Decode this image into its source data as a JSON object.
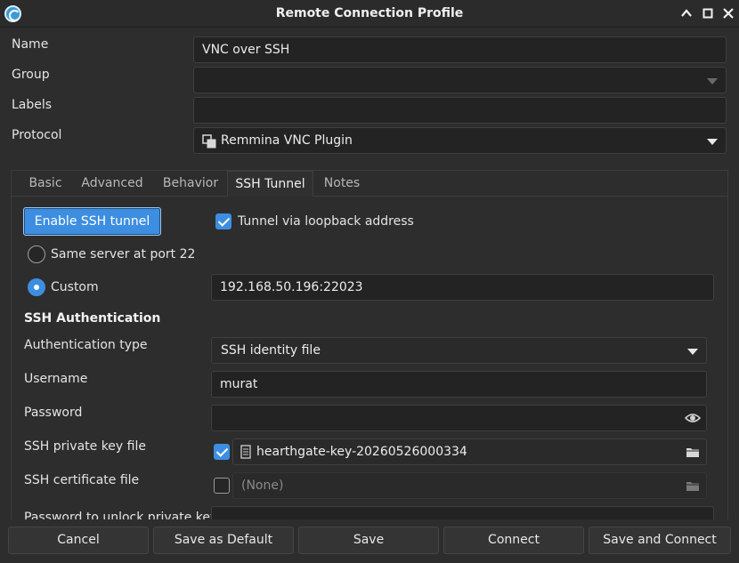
{
  "window": {
    "title": "Remote Connection Profile"
  },
  "form": {
    "name_label": "Name",
    "name_value": "VNC over SSH",
    "group_label": "Group",
    "group_value": "",
    "labels_label": "Labels",
    "labels_value": "",
    "protocol_label": "Protocol",
    "protocol_value": "Remmina VNC Plugin"
  },
  "tabs": [
    {
      "label": "Basic",
      "active": false
    },
    {
      "label": "Advanced",
      "active": false
    },
    {
      "label": "Behavior",
      "active": false
    },
    {
      "label": "SSH Tunnel",
      "active": true
    },
    {
      "label": "Notes",
      "active": false
    }
  ],
  "ssh_tunnel": {
    "enable_button": "Enable SSH tunnel",
    "loopback_label": "Tunnel via loopback address",
    "loopback_checked": true,
    "same_server_label": "Same server at port 22",
    "same_server_selected": false,
    "custom_label": "Custom",
    "custom_selected": true,
    "custom_value": "192.168.50.196:22023",
    "auth_heading": "SSH Authentication",
    "auth_type_label": "Authentication type",
    "auth_type_value": "SSH identity file",
    "username_label": "Username",
    "username_value": "murat",
    "password_label": "Password",
    "password_value": "",
    "private_key_label": "SSH private key file",
    "private_key_checked": true,
    "private_key_value": "hearthgate-key-20260526000334",
    "certificate_label": "SSH certificate file",
    "certificate_checked": false,
    "certificate_value": "(None)",
    "unlock_label": "Password to unlock private key"
  },
  "buttons": {
    "cancel": "Cancel",
    "save_default": "Save as Default",
    "save": "Save",
    "connect": "Connect",
    "save_connect": "Save and Connect"
  },
  "colors": {
    "accent": "#3d8ee0",
    "background": "#2d2d2d",
    "field": "#232323"
  }
}
